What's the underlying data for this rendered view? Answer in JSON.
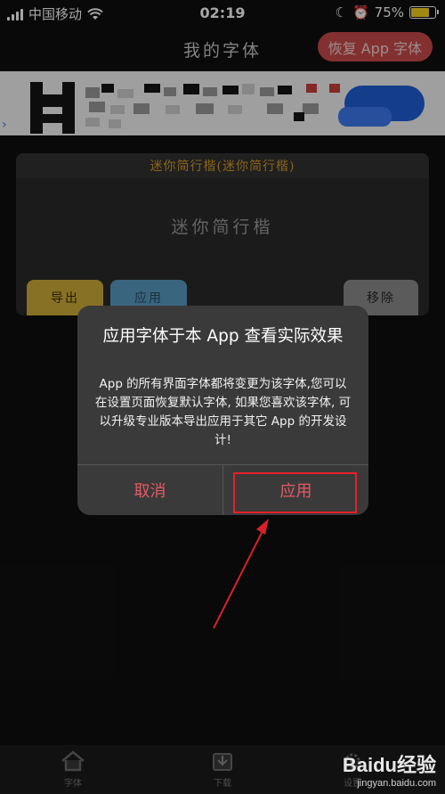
{
  "status_bar": {
    "carrier": "中国移动",
    "time": "02:19",
    "battery": "75%",
    "battery_fill": 0.75
  },
  "nav": {
    "title": "我的字体",
    "restore_label": "恢复 App 字体"
  },
  "font_card": {
    "header": "迷你简行楷(迷你简行楷)",
    "preview": "迷你简行楷",
    "export_label": "导出",
    "apply_label": "应用",
    "remove_label": "移除"
  },
  "tabbar": {
    "tabs": [
      {
        "label": "字体",
        "icon": "house-icon"
      },
      {
        "label": "下载",
        "icon": "download-icon"
      },
      {
        "label": "设置",
        "icon": "gear-icon"
      }
    ]
  },
  "alert": {
    "title": "应用字体于本 App 查看实际效果",
    "message": "App 的所有界面字体都将变更为该字体,您可以在设置页面恢复默认字体, 如果您喜欢该字体, 可以升级专业版本导出应用于其它 App 的开发设计!",
    "cancel_label": "取消",
    "apply_label": "应用"
  },
  "watermark": {
    "logo": "Baidu经验",
    "site": "jingyan.baidu.com"
  },
  "colors": {
    "accent_red": "#e35b66",
    "restore_button": "#c94a4a",
    "export_button": "#cfae38",
    "apply_button": "#5a9cc4",
    "remove_button": "#8d8d8d",
    "card_header_text": "#d59a2a",
    "annotation_red": "#e5202a"
  }
}
